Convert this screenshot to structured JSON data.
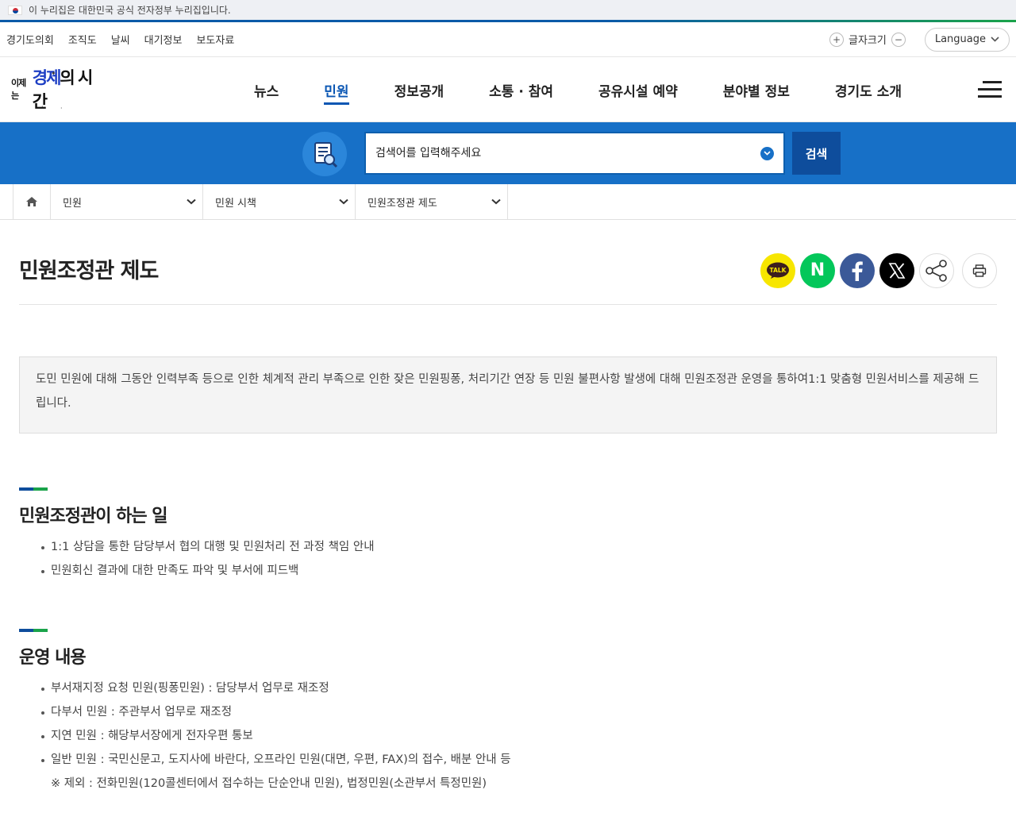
{
  "gov_banner": {
    "text": "이 누리집은 대한민국 공식 전자정부 누리집입니다."
  },
  "util": {
    "links": [
      "경기도의회",
      "조직도",
      "날씨",
      "대기정보",
      "보도자료"
    ],
    "fontsize_label": "글자크기",
    "language_label": "Language"
  },
  "logo": {
    "small": "이제는",
    "main_blue": "경제",
    "main_rest": "의 시간"
  },
  "gnb": [
    {
      "label": "뉴스",
      "active": false
    },
    {
      "label": "민원",
      "active": true
    },
    {
      "label": "정보공개",
      "active": false
    },
    {
      "label": "소통 · 참여",
      "active": false
    },
    {
      "label": "공유시설 예약",
      "active": false
    },
    {
      "label": "분야별 정보",
      "active": false
    },
    {
      "label": "경기도 소개",
      "active": false
    }
  ],
  "search": {
    "placeholder": "검색어를 입력해주세요",
    "button": "검색"
  },
  "breadcrumb": [
    "민원",
    "민원 시책",
    "민원조정관 제도"
  ],
  "page_title": "민원조정관 제도",
  "share": {
    "kakao": "TALK",
    "naver": "N"
  },
  "intro": "도민 민원에 대해 그동안 인력부족 등으로 인한 체계적 관리 부족으로 인한 잦은 민원핑퐁, 처리기간 연장 등 민원 불편사항 발생에 대해 민원조정관 운영을 통하여1:1 맞춤형 민원서비스를 제공해 드립니다.",
  "sections": [
    {
      "title": "민원조정관이 하는 일",
      "items": [
        "1:1 상담을 통한 담당부서 협의 대행 및 민원처리 전 과정 책임 안내",
        "민원회신 결과에 대한 만족도 파악 및 부서에 피드백"
      ]
    },
    {
      "title": "운영 내용",
      "items": [
        "부서재지정 요청 민원(핑퐁민원) : 담당부서 업무로 재조정",
        "다부서 민원 : 주관부서 업무로 재조정",
        "지연 민원 : 해당부서장에게 전자우편 통보",
        "일반 민원 : 국민신문고, 도지사에 바란다, 오프라인 민원(대면, 우편, FAX)의 접수, 배분 안내 등"
      ],
      "note": "※ 제외 : 전화민원(120콜센터에서 접수하는 단순안내 민원), 법정민원(소관부서 특정민원)"
    }
  ],
  "colors": {
    "primary": "#1770c7",
    "dark_blue": "#0e4d9c",
    "active_nav": "#0a56b3",
    "green": "#1aa34a"
  }
}
